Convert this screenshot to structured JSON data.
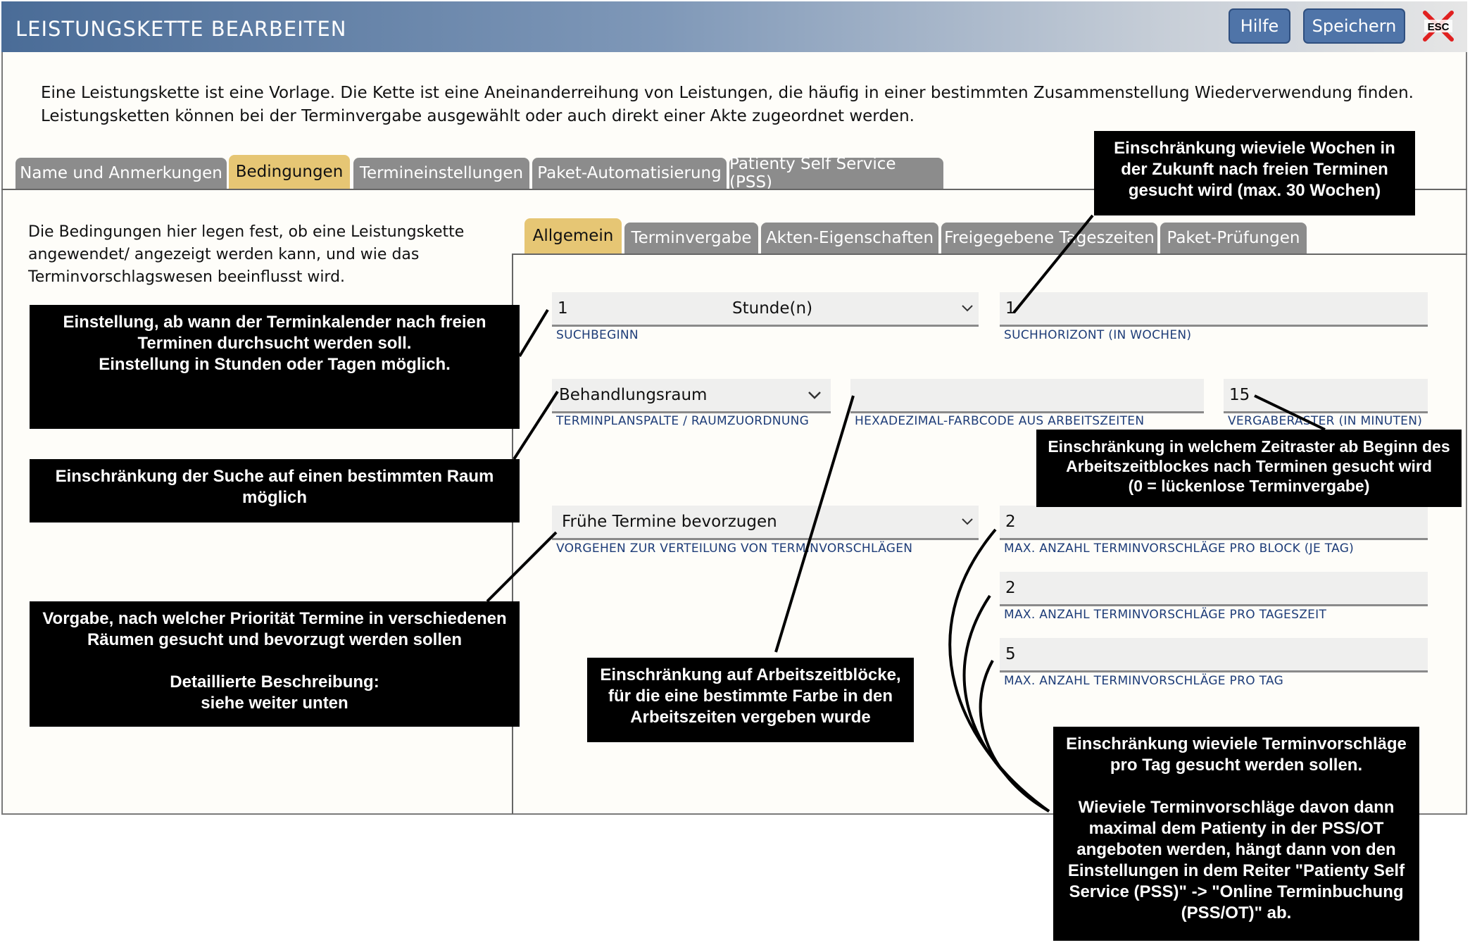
{
  "window": {
    "title": "LEISTUNGSKETTE BEARBEITEN",
    "help_label": "Hilfe",
    "save_label": "Speichern",
    "esc_label": "ESC"
  },
  "intro": "Eine Leistungskette ist eine Vorlage. Die Kette ist eine Aneinanderreihung von Leistungen, die häufig in einer bestimmten Zusammenstellung Wiederverwendung finden. Leistungsketten können bei der Terminvergabe ausgewählt oder auch direkt einer Akte zugeordnet werden.",
  "main_tabs": [
    "Name und Anmerkungen",
    "Bedingungen",
    "Termineinstellungen",
    "Paket-Automatisierung",
    "Patienty Self Service (PSS)"
  ],
  "description": "Die Bedingungen hier legen fest, ob eine Leistungskette angewendet/ angezeigt werden kann, und wie das Terminvorschlagswesen beeinflusst wird.",
  "sub_tabs": [
    "Allgemein",
    "Terminvergabe",
    "Akten-Eigenschaften",
    "Freigegebene Tageszeiten",
    "Paket-Prüfungen"
  ],
  "fields": {
    "suchbeginn": {
      "value": "1",
      "unit": "Stunde(n)",
      "label": "SUCHBEGINN"
    },
    "suchhorizont": {
      "value": "1",
      "label": "SUCHHORIZONT (IN WOCHEN)"
    },
    "raum": {
      "value": "Behandlungsraum",
      "label": "TERMINPLANSPALTE / RAUMZUORDNUNG"
    },
    "farbcode": {
      "value": "",
      "label": "HEXADEZIMAL-FARBCODE AUS ARBEITSZEITEN"
    },
    "raster": {
      "value": "15",
      "label": "VERGABERASTER (IN MINUTEN)"
    },
    "vorgehen": {
      "value": "Frühe Termine bevorzugen",
      "label": "VORGEHEN ZUR VERTEILUNG VON TERMINVORSCHLÄGEN"
    },
    "pro_block": {
      "value": "2",
      "label": "MAX. ANZAHL TERMINVORSCHLÄGE PRO BLOCK (JE TAG)"
    },
    "pro_tageszeit": {
      "value": "2",
      "label": "MAX. ANZAHL TERMINVORSCHLÄGE PRO TAGESZEIT"
    },
    "pro_tag": {
      "value": "5",
      "label": "MAX. ANZAHL TERMINVORSCHLÄGE PRO TAG"
    }
  },
  "callouts": {
    "suchbeginn": [
      "Einstellung, ab wann der Terminkalender nach freien",
      "Terminen durchsucht werden soll.",
      "Einstellung in Stunden oder Tagen möglich."
    ],
    "raum": [
      "Einschränkung der Suche auf einen bestimmten Raum",
      "möglich"
    ],
    "vorgehen": [
      "Vorgabe, nach welcher Priorität Termine in verschiedenen",
      "Räumen gesucht und bevorzugt werden sollen",
      "",
      "Detaillierte Beschreibung:",
      "siehe weiter unten"
    ],
    "farbe": [
      "Einschränkung auf Arbeitszeitblöcke,",
      "für die eine bestimmte Farbe in den",
      "Arbeitszeiten vergeben wurde"
    ],
    "horizont": [
      "Einschränkung wieviele Wochen in",
      "der Zukunft nach freien Terminen",
      "gesucht wird (max. 30 Wochen)"
    ],
    "raster": [
      "Einschränkung in welchem Zeitraster ab Beginn des",
      "Arbeitszeitblockes nach Terminen gesucht wird",
      "(0 = lückenlose Terminvergabe)"
    ],
    "anzahl": [
      "Einschränkung wieviele Terminvorschläge",
      "pro Tag gesucht werden sollen.",
      "",
      "Wieviele Terminvorschläge davon dann",
      "maximal dem Patienty in der PSS/OT",
      "angeboten werden, hängt dann von  den",
      "Einstellungen in dem Reiter \"Patienty Self",
      "Service (PSS)\" -> \"Online Terminbuchung",
      "(PSS/OT)\" ab."
    ]
  }
}
